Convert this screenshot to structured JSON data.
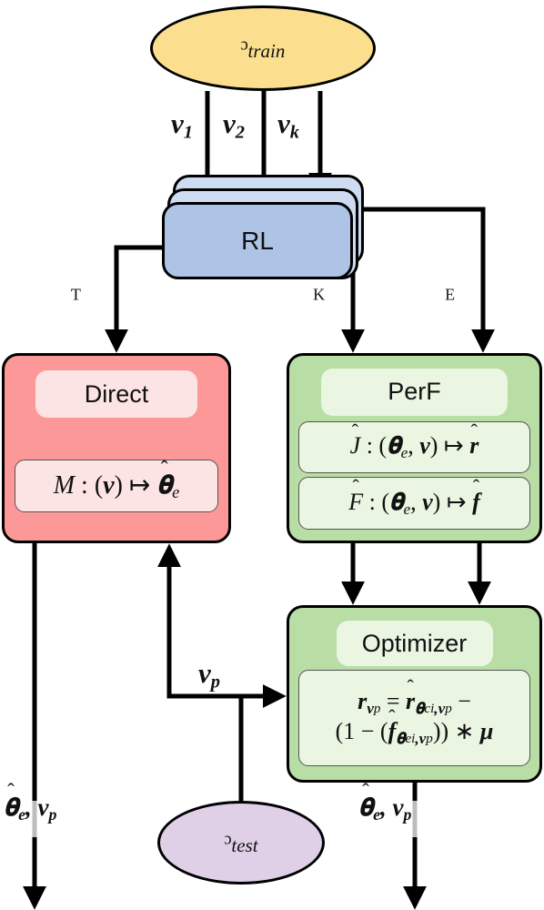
{
  "diagram": {
    "title": "RL training and evaluation pipeline",
    "nodes": {
      "v_train": {
        "name": "V_train",
        "symbol": "ᵓ",
        "subscript": "train",
        "shape": "ellipse",
        "color": "#FBDF8F"
      },
      "v_test": {
        "name": "V_test",
        "symbol": "ᵓ",
        "subscript": "test",
        "shape": "ellipse",
        "color": "#DFD0E8"
      },
      "rl": {
        "label": "RL",
        "shape": "stacked-card",
        "color": "#AEC4E6",
        "back_color": "#CDDCF0",
        "copies": 3
      },
      "direct": {
        "header": "Direct",
        "color": "#FC9898",
        "pill_color": "#FDE4E4",
        "formulas": [
          {
            "lhs": "M",
            "sep": ":",
            "args": "(v)",
            "map": "↦",
            "rhs": "θ̂",
            "rhs_sub": "e",
            "plain": "M : (v) ↦ θ̂_e"
          }
        ]
      },
      "perf": {
        "header": "PerF",
        "color": "#B8DDA5",
        "pill_color": "#EAF5E2",
        "formulas": [
          {
            "lhs": "Ĵ",
            "sep": ":",
            "args": "(θ_e, v)",
            "map": "↦",
            "rhs": "r̂",
            "plain": "Ĵ : (θ_e, v) ↦ r̂"
          },
          {
            "lhs": "F̂",
            "sep": ":",
            "args": "(θ_e, v)",
            "map": "↦",
            "rhs": "f̂",
            "plain": "F̂ : (θ_e, v) ↦ f̂"
          }
        ]
      },
      "optimizer": {
        "header": "Optimizer",
        "color": "#B8DDA5",
        "pill_color": "#EAF5E2",
        "formulas": [
          {
            "line1": "r_{v_p} = r̂_{θ_{ci},v_p} −",
            "line2": "(1 − (f̂_{θ_{ei},v_p})) * μ",
            "plain": "r_vp = r̂_{θci,vp} − (1 − (f̂_{θei,vp})) * μ"
          }
        ]
      }
    },
    "edge_labels": {
      "v1": "v₁",
      "v2": "v₂",
      "vk": "vₖ",
      "T": "ᵀ",
      "K": "ᴷ",
      "E": "ᴱ",
      "vp": "v_p",
      "output_left": "θ̂_e, v_p",
      "output_right": "θ̂_e, v_p"
    },
    "edges": [
      {
        "from": "v_train",
        "to": "rl",
        "label": "v1"
      },
      {
        "from": "v_train",
        "to": "rl",
        "label": "v2"
      },
      {
        "from": "v_train",
        "to": "rl",
        "label": "vk"
      },
      {
        "from": "rl",
        "to": "direct",
        "label": "T"
      },
      {
        "from": "rl",
        "to": "perf",
        "label": "K"
      },
      {
        "from": "rl",
        "to": "perf",
        "label": "E"
      },
      {
        "from": "perf",
        "to": "optimizer",
        "label": ""
      },
      {
        "from": "v_test",
        "to": "direct",
        "label": "vp"
      },
      {
        "from": "v_test",
        "to": "optimizer",
        "label": "vp"
      },
      {
        "from": "direct",
        "to": "output_left",
        "label": "output_left"
      },
      {
        "from": "optimizer",
        "to": "output_right",
        "label": "output_right"
      }
    ],
    "colors": {
      "stroke": "#000000",
      "yellow": "#FBDF8F",
      "purple": "#DFD0E8",
      "blue": "#AEC4E6",
      "blue_light": "#CDDCF0",
      "red": "#FC9898",
      "red_light": "#FDE4E4",
      "green": "#B8DDA5",
      "green_light": "#EAF5E2"
    }
  }
}
